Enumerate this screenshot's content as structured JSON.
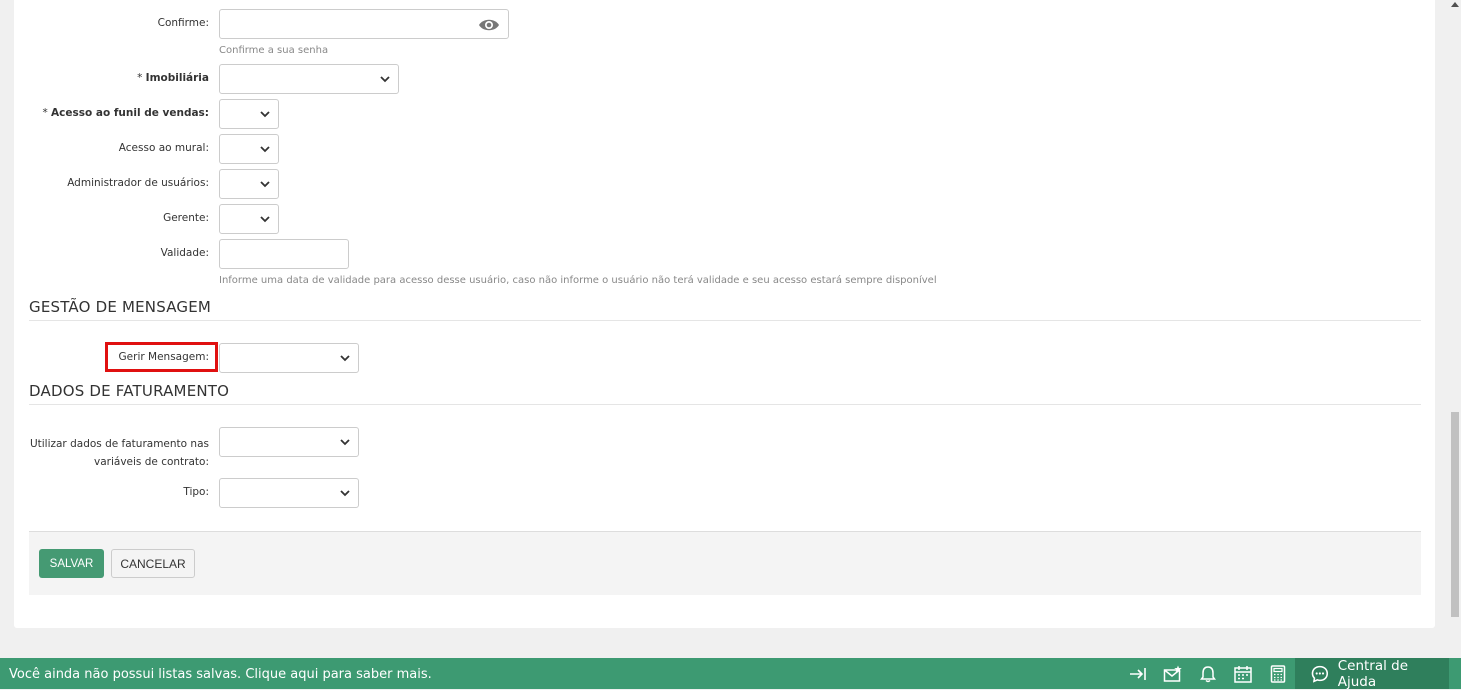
{
  "form": {
    "confirm_label": "Confirme:",
    "confirm_help": "Confirme a sua senha",
    "imobiliaria_required": "*",
    "imobiliaria_label": "Imobiliária",
    "funil_required": "*",
    "funil_label": "Acesso ao funil de vendas:",
    "mural_label": "Acesso ao mural:",
    "admin_label": "Administrador de usuários:",
    "gerente_label": "Gerente:",
    "validade_label": "Validade:",
    "validade_help": "Informe uma data de validade para acesso desse usuário, caso não informe o usuário não terá validade e seu acesso estará sempre disponível"
  },
  "sections": {
    "mensagem_title": "GESTÃO DE MENSAGEM",
    "gerir_label": "Gerir Mensagem:",
    "faturamento_title": "DADOS DE FATURAMENTO",
    "utilizar_label_line1": "Utilizar dados de faturamento nas",
    "utilizar_label_line2": "variáveis de contrato:",
    "tipo_label": "Tipo:"
  },
  "buttons": {
    "save": "SALVAR",
    "cancel": "CANCELAR"
  },
  "bottombar": {
    "message": "Você ainda não possui listas salvas. Clique aqui para saber mais.",
    "help": "Central de Ajuda",
    "icons": [
      "collapse-icon",
      "mail-star-icon",
      "bell-icon",
      "calendar-icon",
      "calculator-icon",
      "chat-icon"
    ]
  },
  "colors": {
    "accent": "#459a73",
    "bar": "#3d9a72",
    "highlight": "#e01010"
  }
}
